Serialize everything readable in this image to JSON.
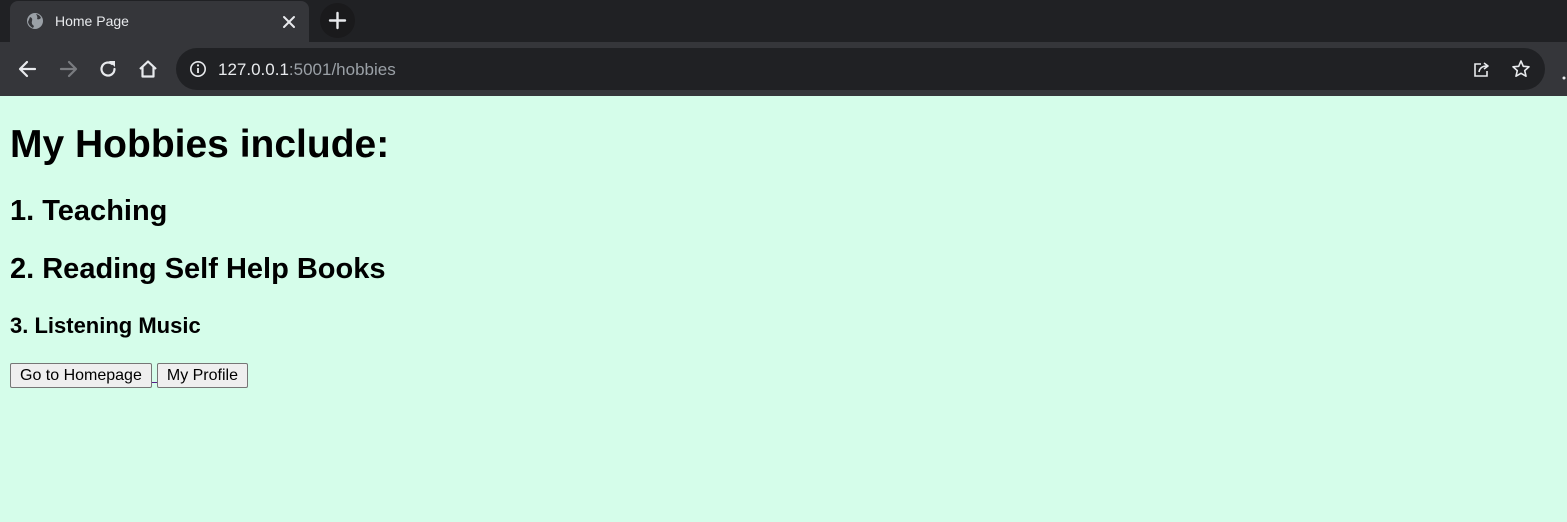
{
  "browser": {
    "tab": {
      "title": "Home Page"
    },
    "address_bar": {
      "url_host": "127.0.0.1",
      "url_rest": ":5001/hobbies"
    }
  },
  "page": {
    "background": "#d5fdea",
    "heading": "My Hobbies include:",
    "hobbies": [
      "1. Teaching",
      "2. Reading Self Help Books",
      "3. Listening Music"
    ],
    "buttons": {
      "homepage": "Go to Homepage",
      "profile": "My Profile"
    }
  },
  "icons": [
    "globe-icon",
    "close-icon",
    "plus-icon",
    "back-arrow-icon",
    "forward-arrow-icon",
    "reload-icon",
    "home-icon",
    "info-icon",
    "share-icon",
    "star-icon"
  ]
}
